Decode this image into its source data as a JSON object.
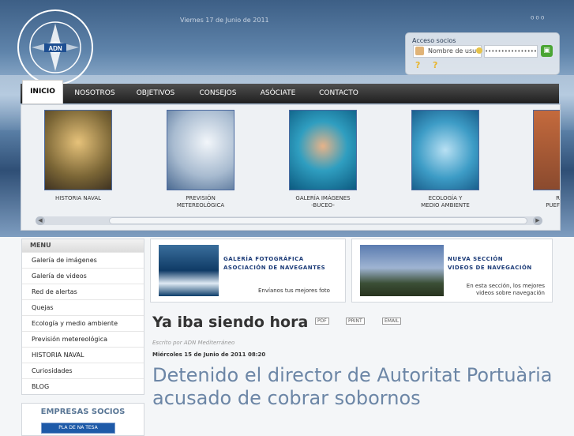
{
  "header": {
    "logo_text": "ASOCIACIÓN DE NAVEGANTES ADN MEDITERRÁNEO",
    "date": "Viernes 17 de Junio de 2011"
  },
  "login": {
    "title": "Acceso socios",
    "username_value": "Nombre de usu",
    "password_value": "•••••••••••••••••"
  },
  "nav": {
    "items": [
      "INICIO",
      "NOSOTROS",
      "OBJETIVOS",
      "CONSEJOS",
      "ASÓCIATE",
      "CONTACTO"
    ]
  },
  "carousel": {
    "slides": [
      {
        "line1": "HISTORIA NAVAL",
        "line2": ""
      },
      {
        "line1": "PREVISIÓN",
        "line2": "METEREOLÓGICA"
      },
      {
        "line1": "GALERÍA IMÁGENES",
        "line2": "-BUCEO-"
      },
      {
        "line1": "ECOLOGÍA Y",
        "line2": "MEDIO AMBIENTE"
      },
      {
        "line1": "R",
        "line2": "PUEF"
      }
    ]
  },
  "menu": {
    "title": "MENU",
    "items": [
      "Galería de imágenes",
      "Galería de videos",
      "Red de alertas",
      "Quejas",
      "Ecología y medio ambiente",
      "Previsión metereológica",
      "HISTORIA NAVAL",
      "Curiosidades",
      "BLOG"
    ]
  },
  "empresas": {
    "title": "EMPRESAS SOCIOS",
    "logo_text": "PLA DE NA TESA"
  },
  "banners": [
    {
      "line1": "GALERÍA FOTOGRÁFICA",
      "line2": "ASOCIACIÓN DE NAVEGANTES",
      "sub1": "Envíanos tus mejores foto",
      "sub2": ""
    },
    {
      "line1": "NUEVA SECCIÓN",
      "line2": "VIDEOS DE NAVEGACIÓN",
      "sub1": "En esta sección, los mejores",
      "sub2": "videos sobre navegación"
    }
  ],
  "article": {
    "title": "Ya iba siendo hora",
    "pdf_label": "PDF",
    "print_label": "PRINT",
    "email_label": "EMAIL",
    "author": "Escrito por ADN Mediterráneo",
    "date": "Miércoles 15 de Junio de 2011 08:20",
    "headline": "Detenido el director de Autoritat Portuària acusado de cobrar sobornos"
  }
}
